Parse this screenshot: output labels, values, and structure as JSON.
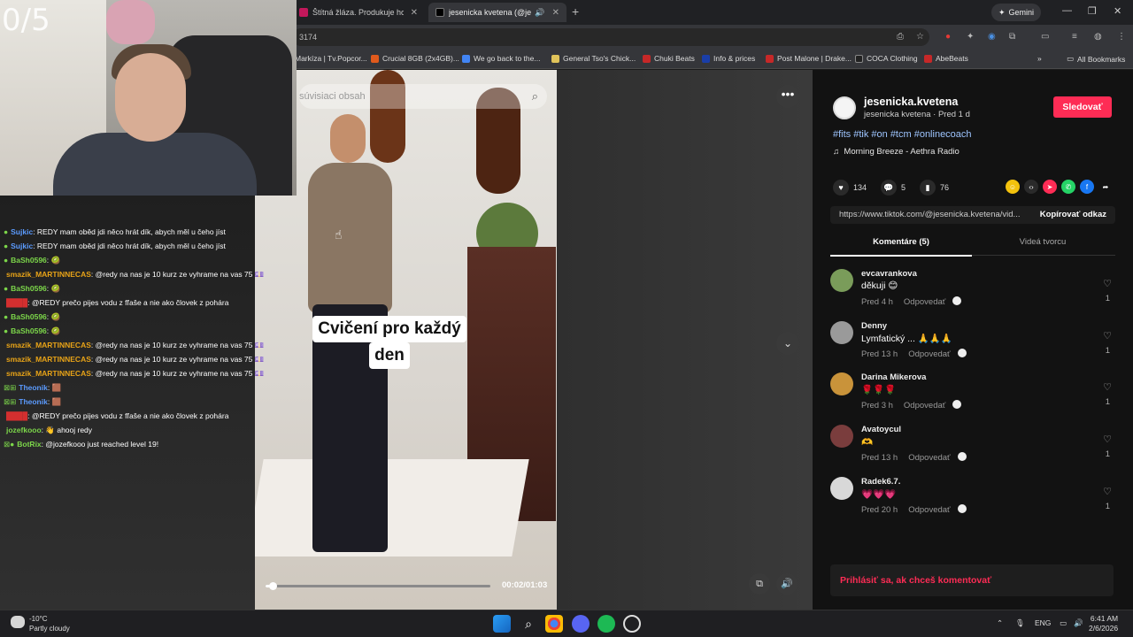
{
  "browser": {
    "tabs": [
      {
        "title": "Štítná žláza. Produkuje horm",
        "favicon_color": "#c2185b"
      },
      {
        "title": "jesenicka kvetena (@jesenic",
        "favicon_color": "#000000"
      }
    ],
    "gemini_label": "Gemini",
    "url": "3174",
    "bookmarks": [
      {
        "label": "Markíza | Tv.Popcor...",
        "color": "#7b3fa0"
      },
      {
        "label": "Crucial 8GB (2x4GB)...",
        "color": "#e05a1c"
      },
      {
        "label": "We go back to the...",
        "color": "#4285f4"
      },
      {
        "label": "General Tso's Chick...",
        "color": "#e0c35a"
      },
      {
        "label": "Chuki Beats",
        "color": "#c62828"
      },
      {
        "label": "Info & prices",
        "color": "#1a3ea8"
      },
      {
        "label": "Post Malone | Drake...",
        "color": "#c62828"
      },
      {
        "label": "COCA Clothing",
        "color": "#222222"
      },
      {
        "label": "AbeBeats",
        "color": "#c62828"
      }
    ],
    "all_bookmarks": "All Bookmarks"
  },
  "stream": {
    "counter": "0/5",
    "chat": [
      {
        "badge": "●",
        "user": "Sujkic",
        "user_color": "#5b9bff",
        "msg": ": REDY mam oběd jdi něco hrát dík, abych měl u čeho jíst"
      },
      {
        "badge": "●",
        "user": "Sujkic",
        "user_color": "#5b9bff",
        "msg": ": REDY mam oběd jdi něco hrát dík, abych měl u čeho jíst"
      },
      {
        "badge": "●",
        "user": "BaSh0596",
        "user_color": "#7cd64a",
        "msg": ": 🥝"
      },
      {
        "badge": "",
        "user": "smazik_MARTINNECAS",
        "user_color": "#e8a317",
        "msg": ": @redy na nas je 10 kurz ze vyhrame na vas 75 💷"
      },
      {
        "badge": "●",
        "user": "BaSh0596",
        "user_color": "#7cd64a",
        "msg": ": 🥝"
      },
      {
        "badge": "",
        "user": "████",
        "user_color": "#d32f2f",
        "msg": ": @REDY prečo pijes vodu z fľaše a nie ako človek z pohára"
      },
      {
        "badge": "●",
        "user": "BaSh0596",
        "user_color": "#7cd64a",
        "msg": ": 🥝"
      },
      {
        "badge": "●",
        "user": "BaSh0596",
        "user_color": "#7cd64a",
        "msg": ": 🥝"
      },
      {
        "badge": "",
        "user": "smazik_MARTINNECAS",
        "user_color": "#e8a317",
        "msg": ": @redy na nas je 10 kurz ze vyhrame na vas 75 💷"
      },
      {
        "badge": "",
        "user": "smazik_MARTINNECAS",
        "user_color": "#e8a317",
        "msg": ": @redy na nas je 10 kurz ze vyhrame na vas 75 💷"
      },
      {
        "badge": "",
        "user": "smazik_MARTINNECAS",
        "user_color": "#e8a317",
        "msg": ": @redy na nas je 10 kurz ze vyhrame na vas 75 💷"
      },
      {
        "badge": "⊠⊞",
        "user": "Theonik",
        "user_color": "#5b9bff",
        "msg": ": 🟫"
      },
      {
        "badge": "⊠⊞",
        "user": "Theonik",
        "user_color": "#5b9bff",
        "msg": ": 🟫"
      },
      {
        "badge": "",
        "user": "████",
        "user_color": "#d32f2f",
        "msg": ": @REDY prečo pijes vodu z fľaše a nie ako človek z pohára"
      },
      {
        "badge": "",
        "user": "jozefkooo",
        "user_color": "#7cd64a",
        "msg": ": 👋 ahooj redy"
      },
      {
        "badge": "⊠●",
        "user": "BotRix",
        "user_color": "#7cd64a",
        "msg": ": @jozefkooo just reached level 19!"
      }
    ]
  },
  "video": {
    "search_placeholder": "súvisiaci obsah",
    "caption": [
      "Cvičení pro každý",
      "den"
    ],
    "time": "00:02/01:03",
    "progress": 0.03
  },
  "panel": {
    "username": "jesenicka.kvetena",
    "subline": "jesenicka kvetena · Pred 1 d",
    "follow_label": "Sledovať",
    "tags": "#fits #tik #on #tcm #onlinecoach",
    "music": "Morning Breeze - Aethra Radio",
    "likes": "134",
    "comments": "5",
    "saves": "76",
    "url": "https://www.tiktok.com/@jesenicka.kvetena/vid...",
    "copy_label": "Kopírovať odkaz",
    "tab_comments": "Komentáre (5)",
    "tab_videos": "Videá tvorcu",
    "comment_list": [
      {
        "name": "evcavrankova",
        "text": "děkuji 😊",
        "time": "Pred 4 h",
        "reply": "Odpovedať",
        "likes": "1",
        "avatar_color": "#7a9c5a"
      },
      {
        "name": "Denny",
        "text": "Lymfatický ... 🙏🙏🙏",
        "time": "Pred 13 h",
        "reply": "Odpovedať",
        "likes": "1",
        "avatar_color": "#9a9a9a"
      },
      {
        "name": "Darina Mikerova",
        "text": "🌹🌹🌹",
        "time": "Pred 3 h",
        "reply": "Odpovedať",
        "likes": "1",
        "avatar_color": "#c9933a"
      },
      {
        "name": "Avatoycul",
        "text": "🫶",
        "time": "Pred 13 h",
        "reply": "Odpovedať",
        "likes": "1",
        "avatar_color": "#7a3d3d"
      },
      {
        "name": "Radek6.7.",
        "text": "💗💗💗",
        "time": "Pred 20 h",
        "reply": "Odpovedať",
        "likes": "1",
        "avatar_color": "#d8d8d8"
      }
    ],
    "login_prompt": "Prihlásiť sa, ak chceš komentovať"
  },
  "taskbar": {
    "temp": "-10°C",
    "weather": "Partly cloudy",
    "lang": "ENG",
    "time": "6:41 AM",
    "date": "2/6/2026"
  }
}
